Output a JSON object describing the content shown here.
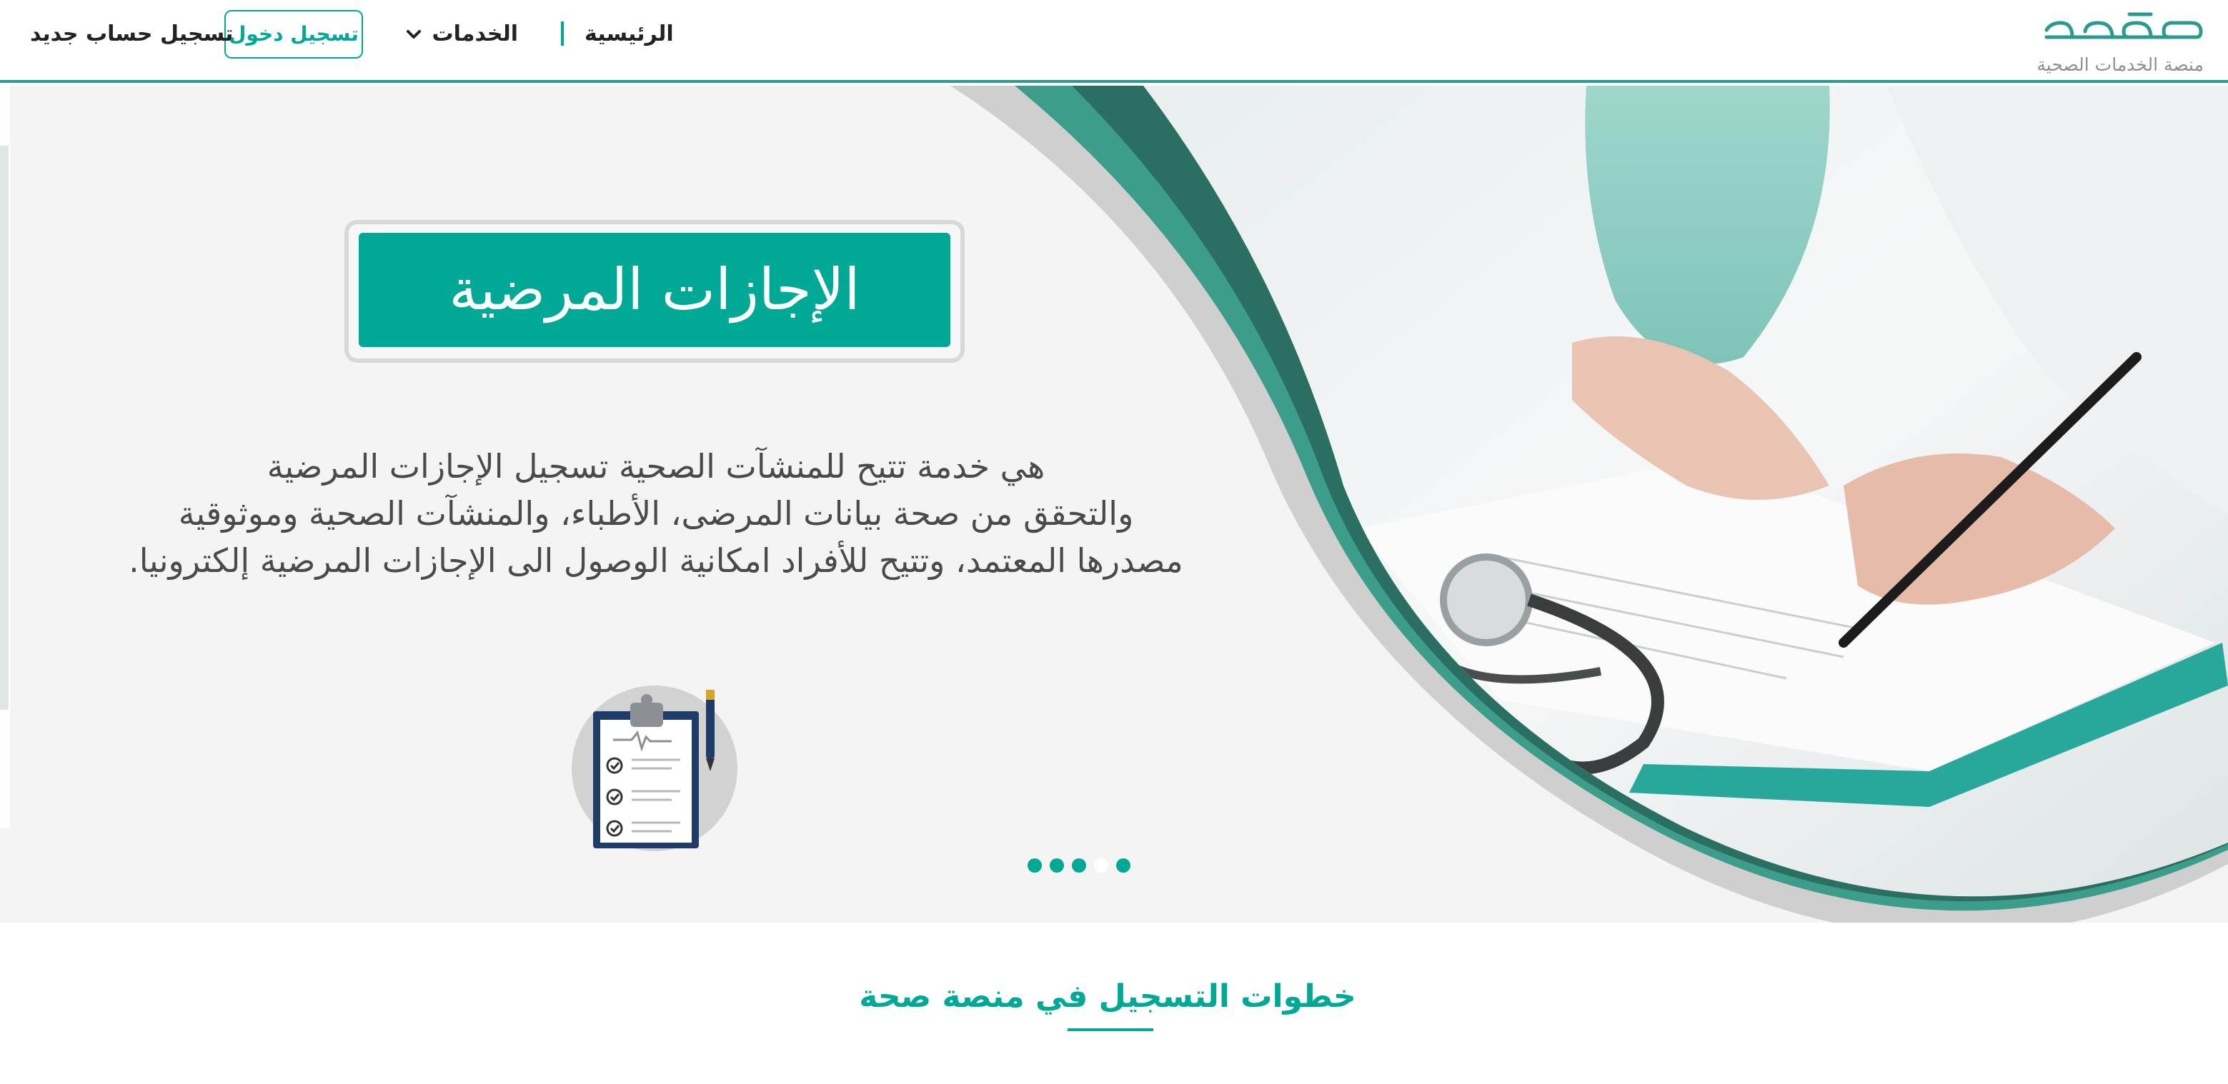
{
  "header": {
    "logo_text": "صحة",
    "logo_tagline": "منصة الخدمات الصحية",
    "nav_home": "الرئيسية",
    "nav_services": "الخدمات",
    "login_button": "تسجيل دخول",
    "register_link": "تسجيل حساب جديد"
  },
  "hero": {
    "title": "الإجازات المرضية",
    "description_lines": [
      "هي خدمة تتيح للمنشآت الصحية تسجيل الإجازات المرضية",
      "والتحقق من صحة بيانات المرضى، الأطباء، والمنشآت الصحية وموثوقية",
      "مصدرها المعتمد، وتتيح للأفراد امكانية الوصول الى الإجازات المرضية إلكترونيا."
    ],
    "icon": "clipboard-checklist-icon",
    "carousel": {
      "slide_count": 5,
      "active_index": 3
    }
  },
  "steps": {
    "title": "خطوات التسجيل في منصة صحة"
  },
  "colors": {
    "brand": "#00a896",
    "brand_dark": "#2b7a6e",
    "text": "#222222",
    "hero_bg": "#f4f4f4"
  }
}
